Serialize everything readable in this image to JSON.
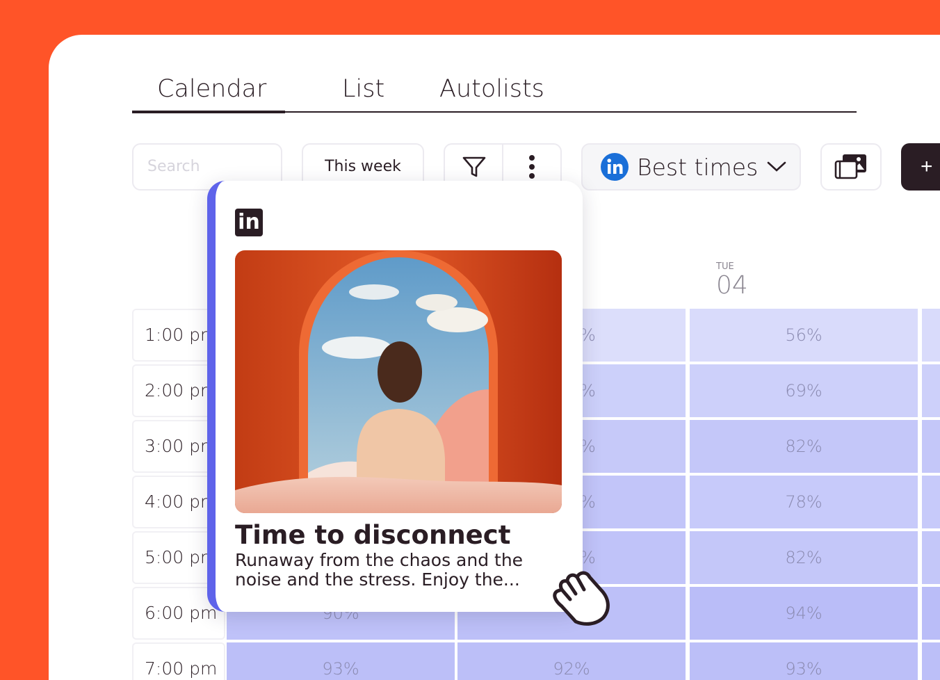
{
  "tabs": [
    {
      "label": "Calendar",
      "active": true
    },
    {
      "label": "List",
      "active": false
    },
    {
      "label": "Autolists",
      "active": false
    }
  ],
  "toolbar": {
    "search_placeholder": "Search",
    "range_label": "This week",
    "filter_icon": "filter-icon",
    "more_icon": "more-vertical-icon",
    "best_times_label": "Best times",
    "best_times_network": "linkedin-icon",
    "media_icon": "media-library-icon",
    "add_label": "+"
  },
  "calendar": {
    "visible_day": {
      "name": "TUE",
      "number": "04"
    },
    "times": [
      "1:00 pm",
      "2:00 pm",
      "3:00 pm",
      "4:00 pm",
      "5:00 pm",
      "6:00 pm",
      "7:00 pm"
    ],
    "columns": [
      {
        "values": [
          "",
          "",
          "",
          "",
          "",
          "90%",
          "93%"
        ]
      },
      {
        "values": [
          "%",
          "%",
          "%",
          "%",
          "%",
          "",
          "92%"
        ]
      },
      {
        "values": [
          "56%",
          "69%",
          "82%",
          "78%",
          "82%",
          "94%",
          "93%"
        ]
      }
    ]
  },
  "post_card": {
    "network_icon": "linkedin-icon",
    "network_badge": "in",
    "title": "Time to disconnect",
    "text": "Runaway from the chaos and the noise and the stress. Enjoy the...",
    "accent_color": "#5e63ea"
  },
  "colors": {
    "brand": "#ff5428",
    "dark": "#2a1d24",
    "heat_low": "#d9dbfb",
    "heat_high": "#b9bdf8"
  }
}
